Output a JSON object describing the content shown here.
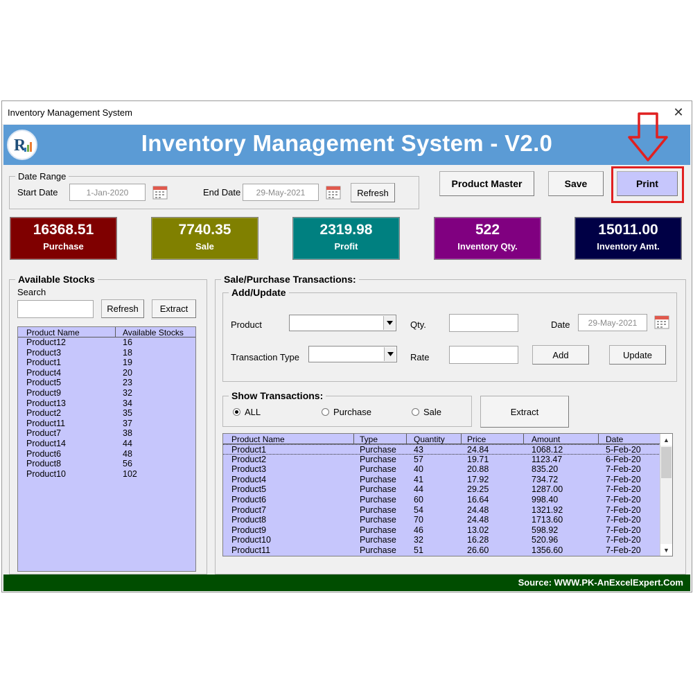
{
  "window": {
    "title": "Inventory Management System",
    "close_glyph": "✕"
  },
  "banner": {
    "title": "Inventory Management System - V2.0",
    "logo_letter": "R"
  },
  "date_range": {
    "legend": "Date Range",
    "start_label": "Start Date",
    "start_value": "1-Jan-2020",
    "end_label": "End Date",
    "end_value": "29-May-2021",
    "refresh_label": "Refresh"
  },
  "toolbar": {
    "product_master_label": "Product Master",
    "save_label": "Save",
    "print_label": "Print"
  },
  "kpis": [
    {
      "value": "16368.51",
      "label": "Purchase",
      "color": "#7f0000"
    },
    {
      "value": "7740.35",
      "label": "Sale",
      "color": "#808000"
    },
    {
      "value": "2319.98",
      "label": "Profit",
      "color": "#008080"
    },
    {
      "value": "522",
      "label": "Inventory Qty.",
      "color": "#800080"
    },
    {
      "value": "15011.00",
      "label": "Inventory Amt.",
      "color": "#000045"
    }
  ],
  "stocks": {
    "legend": "Available Stocks",
    "search_label": "Search",
    "search_value": "",
    "refresh_label": "Refresh",
    "extract_label": "Extract",
    "columns": [
      "Product Name",
      "Available Stocks"
    ],
    "rows": [
      [
        "Product12",
        "16"
      ],
      [
        "Product3",
        "18"
      ],
      [
        "Product1",
        "19"
      ],
      [
        "Product4",
        "20"
      ],
      [
        "Product5",
        "23"
      ],
      [
        "Product9",
        "32"
      ],
      [
        "Product13",
        "34"
      ],
      [
        "Product2",
        "35"
      ],
      [
        "Product11",
        "37"
      ],
      [
        "Product7",
        "38"
      ],
      [
        "Product14",
        "44"
      ],
      [
        "Product6",
        "48"
      ],
      [
        "Product8",
        "56"
      ],
      [
        "Product10",
        "102"
      ]
    ]
  },
  "transactions": {
    "legend": "Sale/Purchase Transactions:",
    "add_update": {
      "legend": "Add/Update",
      "product_label": "Product",
      "product_value": "",
      "qty_label": "Qty.",
      "qty_value": "",
      "date_label": "Date",
      "date_value": "29-May-2021",
      "type_label": "Transaction Type",
      "type_value": "",
      "rate_label": "Rate",
      "rate_value": "",
      "add_label": "Add",
      "update_label": "Update"
    },
    "show": {
      "legend": "Show Transactions:",
      "options": [
        "ALL",
        "Purchase",
        "Sale"
      ],
      "selected": "ALL",
      "extract_label": "Extract"
    },
    "columns": [
      "Product Name",
      "Type",
      "Quantity",
      "Price",
      "Amount",
      "Date"
    ],
    "rows": [
      [
        "Product1",
        "Purchase",
        "43",
        "24.84",
        "1068.12",
        "5-Feb-20"
      ],
      [
        "Product2",
        "Purchase",
        "57",
        "19.71",
        "1123.47",
        "6-Feb-20"
      ],
      [
        "Product3",
        "Purchase",
        "40",
        "20.88",
        "835.20",
        "7-Feb-20"
      ],
      [
        "Product4",
        "Purchase",
        "41",
        "17.92",
        "734.72",
        "7-Feb-20"
      ],
      [
        "Product5",
        "Purchase",
        "44",
        "29.25",
        "1287.00",
        "7-Feb-20"
      ],
      [
        "Product6",
        "Purchase",
        "60",
        "16.64",
        "998.40",
        "7-Feb-20"
      ],
      [
        "Product7",
        "Purchase",
        "54",
        "24.48",
        "1321.92",
        "7-Feb-20"
      ],
      [
        "Product8",
        "Purchase",
        "70",
        "24.48",
        "1713.60",
        "7-Feb-20"
      ],
      [
        "Product9",
        "Purchase",
        "46",
        "13.02",
        "598.92",
        "7-Feb-20"
      ],
      [
        "Product10",
        "Purchase",
        "32",
        "16.28",
        "520.96",
        "7-Feb-20"
      ],
      [
        "Product11",
        "Purchase",
        "51",
        "26.60",
        "1356.60",
        "7-Feb-20"
      ]
    ]
  },
  "footer": {
    "source": "Source: WWW.PK-AnExcelExpert.Com"
  },
  "colors": {
    "banner": "#5b9bd5",
    "list_bg": "#c6c6fc",
    "footer": "#004d00",
    "print_button": "#c6c6fc",
    "annotation": "#e02020"
  }
}
